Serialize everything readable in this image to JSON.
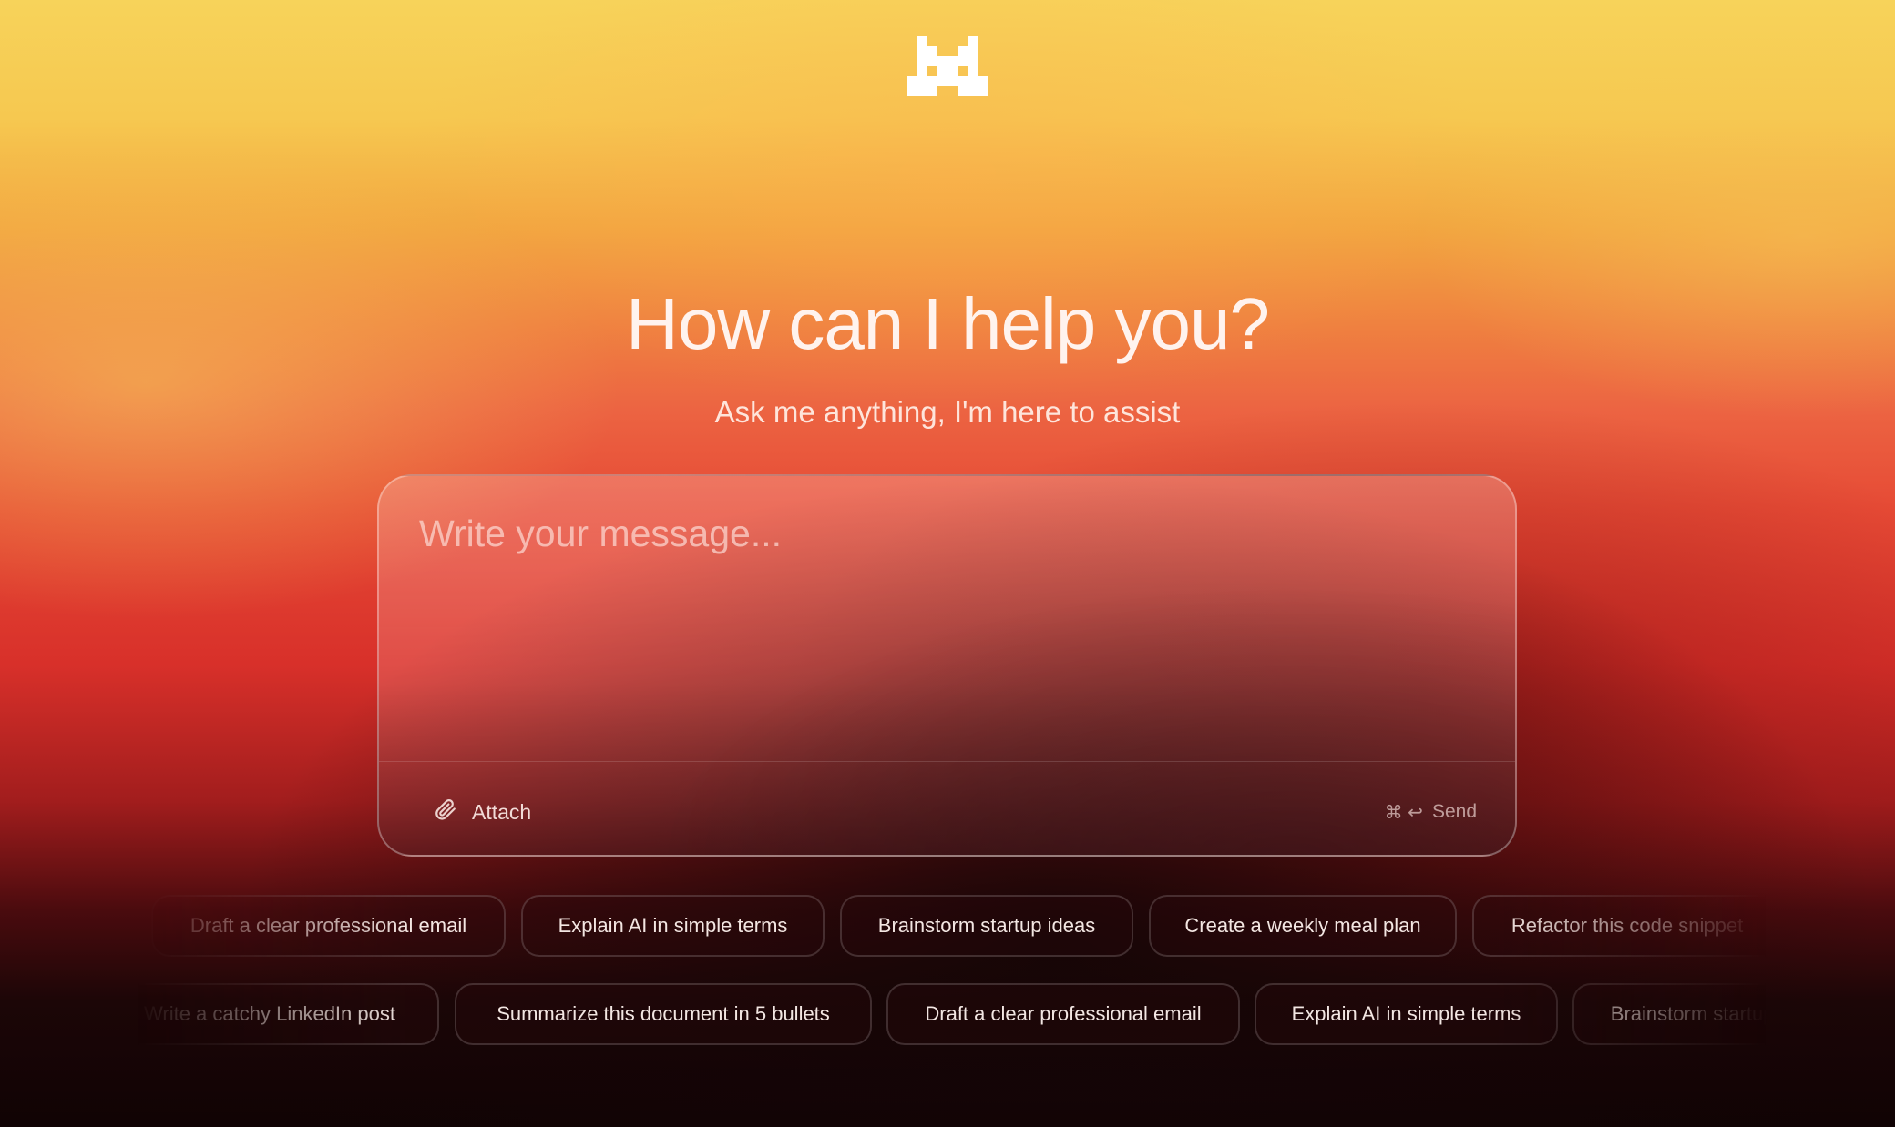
{
  "brand": {
    "logo_icon": "pixel-m-logo-icon"
  },
  "hero": {
    "title": "How can I help you?",
    "subtitle": "Ask me anything, I'm here to assist"
  },
  "composer": {
    "placeholder": "Write your message...",
    "value": "",
    "attach_label": "Attach",
    "attach_icon": "paperclip-icon",
    "send_shortcut": "⌘ ↩",
    "send_label": "Send"
  },
  "suggestions": {
    "row1": [
      "Draft a clear professional email",
      "Explain AI in simple terms",
      "Brainstorm startup ideas",
      "Create a weekly meal plan",
      "Refactor this code snippet"
    ],
    "row2": [
      "Write a catchy LinkedIn post",
      "Summarize this document in 5 bullets",
      "Draft a clear professional email",
      "Explain AI in simple terms",
      "Brainstorm startup ideas"
    ]
  },
  "colors": {
    "background_top": "#f7d35a",
    "background_mid": "#e64a35",
    "background_bottom": "#100304",
    "text": "#fff3ee"
  }
}
